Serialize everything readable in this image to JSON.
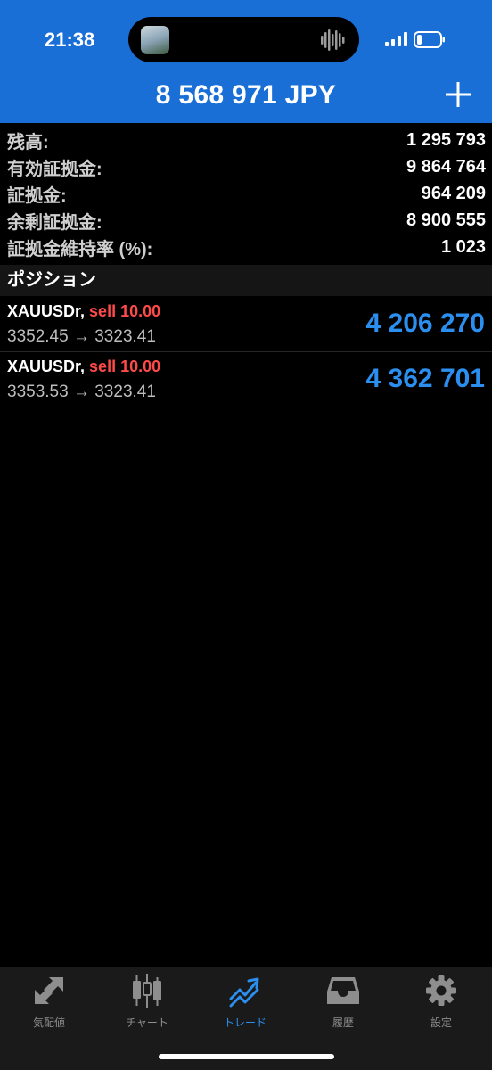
{
  "status_bar": {
    "time": "21:38"
  },
  "header": {
    "balance": "8 568 971 JPY"
  },
  "summary": [
    {
      "label": "残高:",
      "value": "1 295 793"
    },
    {
      "label": "有効証拠金:",
      "value": "9 864 764"
    },
    {
      "label": "証拠金:",
      "value": "964 209"
    },
    {
      "label": "余剰証拠金:",
      "value": "8 900 555"
    },
    {
      "label": "証拠金維持率 (%):",
      "value": "1 023"
    }
  ],
  "positions_section": {
    "title": "ポジション"
  },
  "positions": [
    {
      "symbol": "XAUUSDr,",
      "side": "sell 10.00",
      "prices": "3352.45 → 3323.41",
      "profit": "4 206 270"
    },
    {
      "symbol": "XAUUSDr,",
      "side": "sell 10.00",
      "prices": "3353.53 → 3323.41",
      "profit": "4 362 701"
    }
  ],
  "tabs": [
    {
      "label": "気配値",
      "icon": "quotes-arrows-icon"
    },
    {
      "label": "チャート",
      "icon": "candlestick-chart-icon"
    },
    {
      "label": "トレード",
      "icon": "trade-trend-icon",
      "active": true
    },
    {
      "label": "履歴",
      "icon": "history-inbox-icon"
    },
    {
      "label": "設定",
      "icon": "settings-gear-icon"
    }
  ],
  "colors": {
    "header_bg": "#1a6fd6",
    "profit": "#2b8ff0",
    "sell": "#ff4a4a",
    "active_tab": "#2b8ff0"
  }
}
